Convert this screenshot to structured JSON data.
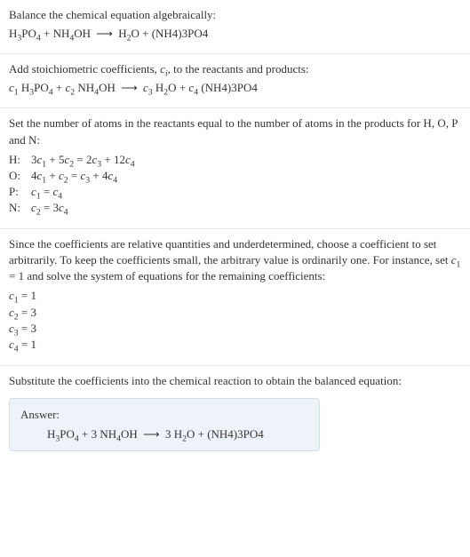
{
  "section1": {
    "intro": "Balance the chemical equation algebraically:",
    "eq_lhs1": "H",
    "eq_lhs1_sub": "3",
    "eq_lhs2": "PO",
    "eq_lhs2_sub": "4",
    "plus1": " + ",
    "eq_lhs3": "NH",
    "eq_lhs3_sub": "4",
    "eq_lhs4": "OH",
    "arrow": "⟶",
    "eq_rhs1": "H",
    "eq_rhs1_sub": "2",
    "eq_rhs2": "O",
    "plus2": " + ",
    "eq_rhs3": "(NH4)3PO4"
  },
  "section2": {
    "intro1": "Add stoichiometric coefficients, ",
    "ci": "c",
    "ci_sub": "i",
    "intro2": ", to the reactants and products:",
    "c1": "c",
    "c1_sub": "1",
    "sp1": " H",
    "sp1_sub": "3",
    "sp1b": "PO",
    "sp1b_sub": "4",
    "plus1": " + ",
    "c2": "c",
    "c2_sub": "2",
    "sp2": " NH",
    "sp2_sub": "4",
    "sp2b": "OH",
    "arrow": "⟶",
    "c3": "c",
    "c3_sub": "3",
    "sp3": " H",
    "sp3_sub": "2",
    "sp3b": "O",
    "plus2": " + ",
    "c4": "c",
    "c4_sub": "4",
    "sp4": " (NH4)3PO4"
  },
  "section3": {
    "intro": "Set the number of atoms in the reactants equal to the number of atoms in the products for H, O, P and N:",
    "rows": [
      {
        "el": "H:",
        "lhs": "3",
        "c1": "c",
        "c1s": "1",
        "p1": " + 5",
        "c2": "c",
        "c2s": "2",
        "eq": " = 2",
        "c3": "c",
        "c3s": "3",
        "p2": " + 12",
        "c4": "c",
        "c4s": "4"
      },
      {
        "el": "O:",
        "lhs": "4",
        "c1": "c",
        "c1s": "1",
        "p1": " + ",
        "c2": "c",
        "c2s": "2",
        "eq": " = ",
        "c3": "c",
        "c3s": "3",
        "p2": " + 4",
        "c4": "c",
        "c4s": "4"
      },
      {
        "el": "P:",
        "lhs": "",
        "c1": "c",
        "c1s": "1",
        "p1": "",
        "c2": "",
        "c2s": "",
        "eq": " = ",
        "c3": "c",
        "c3s": "4",
        "p2": "",
        "c4": "",
        "c4s": ""
      },
      {
        "el": "N:",
        "lhs": "",
        "c1": "c",
        "c1s": "2",
        "p1": "",
        "c2": "",
        "c2s": "",
        "eq": " = 3",
        "c3": "c",
        "c3s": "4",
        "p2": "",
        "c4": "",
        "c4s": ""
      }
    ]
  },
  "section4": {
    "intro1": "Since the coefficients are relative quantities and underdetermined, choose a coefficient to set arbitrarily. To keep the coefficients small, the arbitrary value is ordinarily one. For instance, set ",
    "c1": "c",
    "c1_sub": "1",
    "intro2": " = 1 and solve the system of equations for the remaining coefficients:",
    "lines": [
      {
        "c": "c",
        "cs": "1",
        "val": " = 1"
      },
      {
        "c": "c",
        "cs": "2",
        "val": " = 3"
      },
      {
        "c": "c",
        "cs": "3",
        "val": " = 3"
      },
      {
        "c": "c",
        "cs": "4",
        "val": " = 1"
      }
    ]
  },
  "section5": {
    "intro": "Substitute the coefficients into the chemical reaction to obtain the balanced equation:",
    "answer_label": "Answer:",
    "lhs1": "H",
    "lhs1_sub": "3",
    "lhs1b": "PO",
    "lhs1b_sub": "4",
    "plus1": " + 3 ",
    "lhs2": "NH",
    "lhs2_sub": "4",
    "lhs2b": "OH",
    "arrow": "⟶",
    "rhs1": "3 H",
    "rhs1_sub": "2",
    "rhs1b": "O",
    "plus2": " + ",
    "rhs2": "(NH4)3PO4"
  }
}
